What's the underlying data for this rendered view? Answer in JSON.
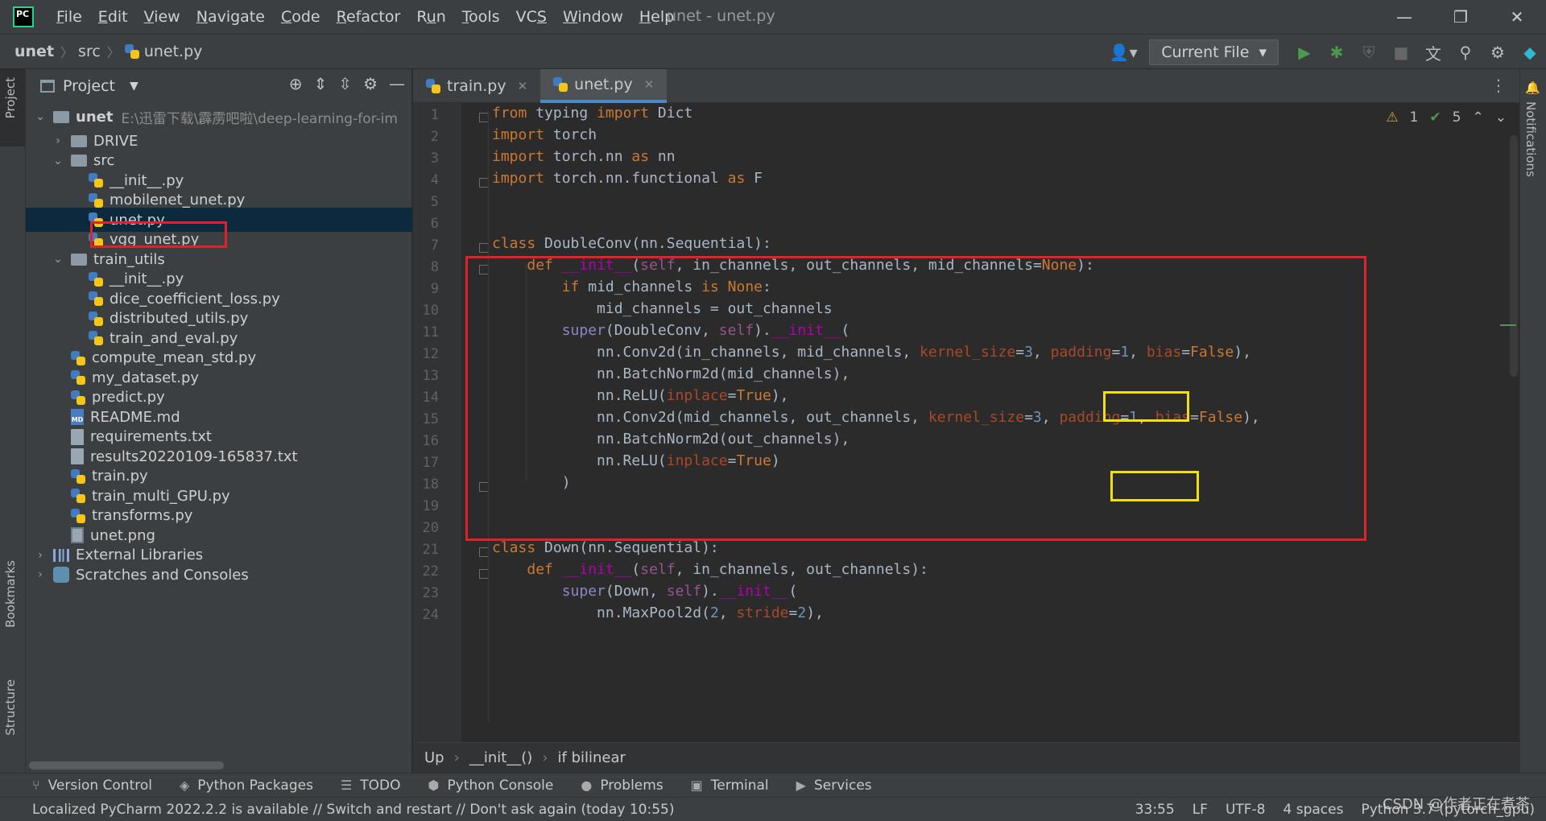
{
  "menubar": {
    "logo_text": "PC",
    "items": [
      {
        "pre": "",
        "u": "F",
        "post": "ile"
      },
      {
        "pre": "",
        "u": "E",
        "post": "dit"
      },
      {
        "pre": "",
        "u": "V",
        "post": "iew"
      },
      {
        "pre": "",
        "u": "N",
        "post": "avigate"
      },
      {
        "pre": "",
        "u": "C",
        "post": "ode"
      },
      {
        "pre": "",
        "u": "R",
        "post": "efactor"
      },
      {
        "pre": "R",
        "u": "u",
        "post": "n"
      },
      {
        "pre": "",
        "u": "T",
        "post": "ools"
      },
      {
        "pre": "VC",
        "u": "S",
        "post": ""
      },
      {
        "pre": "",
        "u": "W",
        "post": "indow"
      },
      {
        "pre": "",
        "u": "H",
        "post": "elp"
      }
    ],
    "window_title": "unet - unet.py"
  },
  "navbar": {
    "crumbs": [
      "unet",
      "src",
      "unet.py"
    ],
    "run_config": "Current File"
  },
  "left_strip": {
    "project": "Project",
    "bookmarks": "Bookmarks",
    "structure": "Structure"
  },
  "right_strip": {
    "notifications": "Notifications"
  },
  "project_panel": {
    "title": "Project",
    "root": {
      "name": "unet",
      "path": "E:\\迅雷下载\\霹雳吧啦\\deep-learning-for-im"
    },
    "items": [
      {
        "name": "DRIVE",
        "kind": "folder",
        "depth": 1,
        "arrow": "›"
      },
      {
        "name": "src",
        "kind": "folder",
        "depth": 1,
        "arrow": "⌄"
      },
      {
        "name": "__init__.py",
        "kind": "py",
        "depth": 2,
        "arrow": ""
      },
      {
        "name": "mobilenet_unet.py",
        "kind": "py",
        "depth": 2,
        "arrow": ""
      },
      {
        "name": "unet.py",
        "kind": "py",
        "depth": 2,
        "arrow": "",
        "selected": true
      },
      {
        "name": "vgg_unet.py",
        "kind": "py",
        "depth": 2,
        "arrow": ""
      },
      {
        "name": "train_utils",
        "kind": "folder",
        "depth": 1,
        "arrow": "⌄"
      },
      {
        "name": "__init__.py",
        "kind": "py",
        "depth": 2,
        "arrow": ""
      },
      {
        "name": "dice_coefficient_loss.py",
        "kind": "py",
        "depth": 2,
        "arrow": ""
      },
      {
        "name": "distributed_utils.py",
        "kind": "py",
        "depth": 2,
        "arrow": ""
      },
      {
        "name": "train_and_eval.py",
        "kind": "py",
        "depth": 2,
        "arrow": ""
      },
      {
        "name": "compute_mean_std.py",
        "kind": "py",
        "depth": 1,
        "arrow": ""
      },
      {
        "name": "my_dataset.py",
        "kind": "py",
        "depth": 1,
        "arrow": ""
      },
      {
        "name": "predict.py",
        "kind": "py",
        "depth": 1,
        "arrow": ""
      },
      {
        "name": "README.md",
        "kind": "md",
        "depth": 1,
        "arrow": ""
      },
      {
        "name": "requirements.txt",
        "kind": "txt",
        "depth": 1,
        "arrow": ""
      },
      {
        "name": "results20220109-165837.txt",
        "kind": "txt",
        "depth": 1,
        "arrow": ""
      },
      {
        "name": "train.py",
        "kind": "py",
        "depth": 1,
        "arrow": ""
      },
      {
        "name": "train_multi_GPU.py",
        "kind": "py",
        "depth": 1,
        "arrow": ""
      },
      {
        "name": "transforms.py",
        "kind": "py",
        "depth": 1,
        "arrow": ""
      },
      {
        "name": "unet.png",
        "kind": "png",
        "depth": 1,
        "arrow": ""
      },
      {
        "name": "External Libraries",
        "kind": "lib",
        "depth": 0,
        "arrow": "›"
      },
      {
        "name": "Scratches and Consoles",
        "kind": "scratch",
        "depth": 0,
        "arrow": "›"
      }
    ]
  },
  "tabs": [
    {
      "label": "train.py",
      "active": false
    },
    {
      "label": "unet.py",
      "active": true
    }
  ],
  "inspections": {
    "warnings": "1",
    "ok": "5"
  },
  "code_lines": [
    "<span class='kw'>from</span> typing <span class='kw'>import</span> Dict",
    "<span class='kw'>import</span> torch",
    "<span class='kw'>import</span> torch.nn <span class='kw'>as</span> nn",
    "<span class='kw'>import</span> torch.nn.functional <span class='kw'>as</span> F",
    "",
    "",
    "<span class='kw'>class</span> DoubleConv(nn.Sequential):",
    "    <span class='kw'>def</span> <span class='fn-magic'>__init__</span>(<span class='self'>self</span>, in_channels, out_channels, mid_channels=<span class='const'>None</span>):",
    "        <span class='kw'>if</span> mid_channels <span class='kw'>is</span> <span class='const'>None</span>:",
    "            mid_channels = out_channels",
    "        <span class='builtin'>super</span>(DoubleConv, <span class='self'>self</span>).<span class='fn-magic'>__init__</span>(",
    "            nn.Conv2d(in_channels, mid_channels, <span class='param'>kernel_size</span>=<span class='num'>3</span>, <span class='param'>padding</span>=<span class='num'>1</span>, <span class='param'>bias</span>=<span class='const'>False</span>),",
    "            nn.BatchNorm2d(mid_channels),",
    "            nn.ReLU(<span class='param'>inplace</span>=<span class='const'>True</span>),",
    "            nn.Conv2d(mid_channels, out_channels, <span class='param'>kernel_size</span>=<span class='num'>3</span>, <span class='param'>padding</span>=<span class='num'>1</span>, <span class='param'>bias</span>=<span class='const'>False</span>),",
    "            nn.BatchNorm2d(out_channels),",
    "            nn.ReLU(<span class='param'>inplace</span>=<span class='const'>True</span>)",
    "        )",
    "",
    "",
    "<span class='kw'>class</span> Down(nn.Sequential):",
    "    <span class='kw'>def</span> <span class='fn-magic'>__init__</span>(<span class='self'>self</span>, in_channels, out_channels):",
    "        <span class='builtin'>super</span>(Down, <span class='self'>self</span>).<span class='fn-magic'>__init__</span>(",
    "            nn.MaxPool2d(<span class='num'>2</span>, <span class='param'>stride</span>=<span class='num'>2</span>),"
  ],
  "code_crumbs": [
    "Up",
    "__init__()",
    "if bilinear"
  ],
  "toolwindows": [
    {
      "label": "Version Control",
      "icon": "⑂"
    },
    {
      "label": "Python Packages",
      "icon": "◈"
    },
    {
      "label": "TODO",
      "icon": "☰"
    },
    {
      "label": "Python Console",
      "icon": "⬢"
    },
    {
      "label": "Problems",
      "icon": "●"
    },
    {
      "label": "Terminal",
      "icon": "▣"
    },
    {
      "label": "Services",
      "icon": "▶"
    }
  ],
  "status": {
    "message": "Localized PyCharm 2022.2.2 is available // Switch and restart // Don't ask again (today 10:55)",
    "position": "33:55",
    "line_sep": "LF",
    "encoding": "UTF-8",
    "indent": "4 spaces",
    "interpreter": "Python 3.7 (pytorch_gpu)"
  },
  "watermark": "CSDN @作者正在煮茶"
}
